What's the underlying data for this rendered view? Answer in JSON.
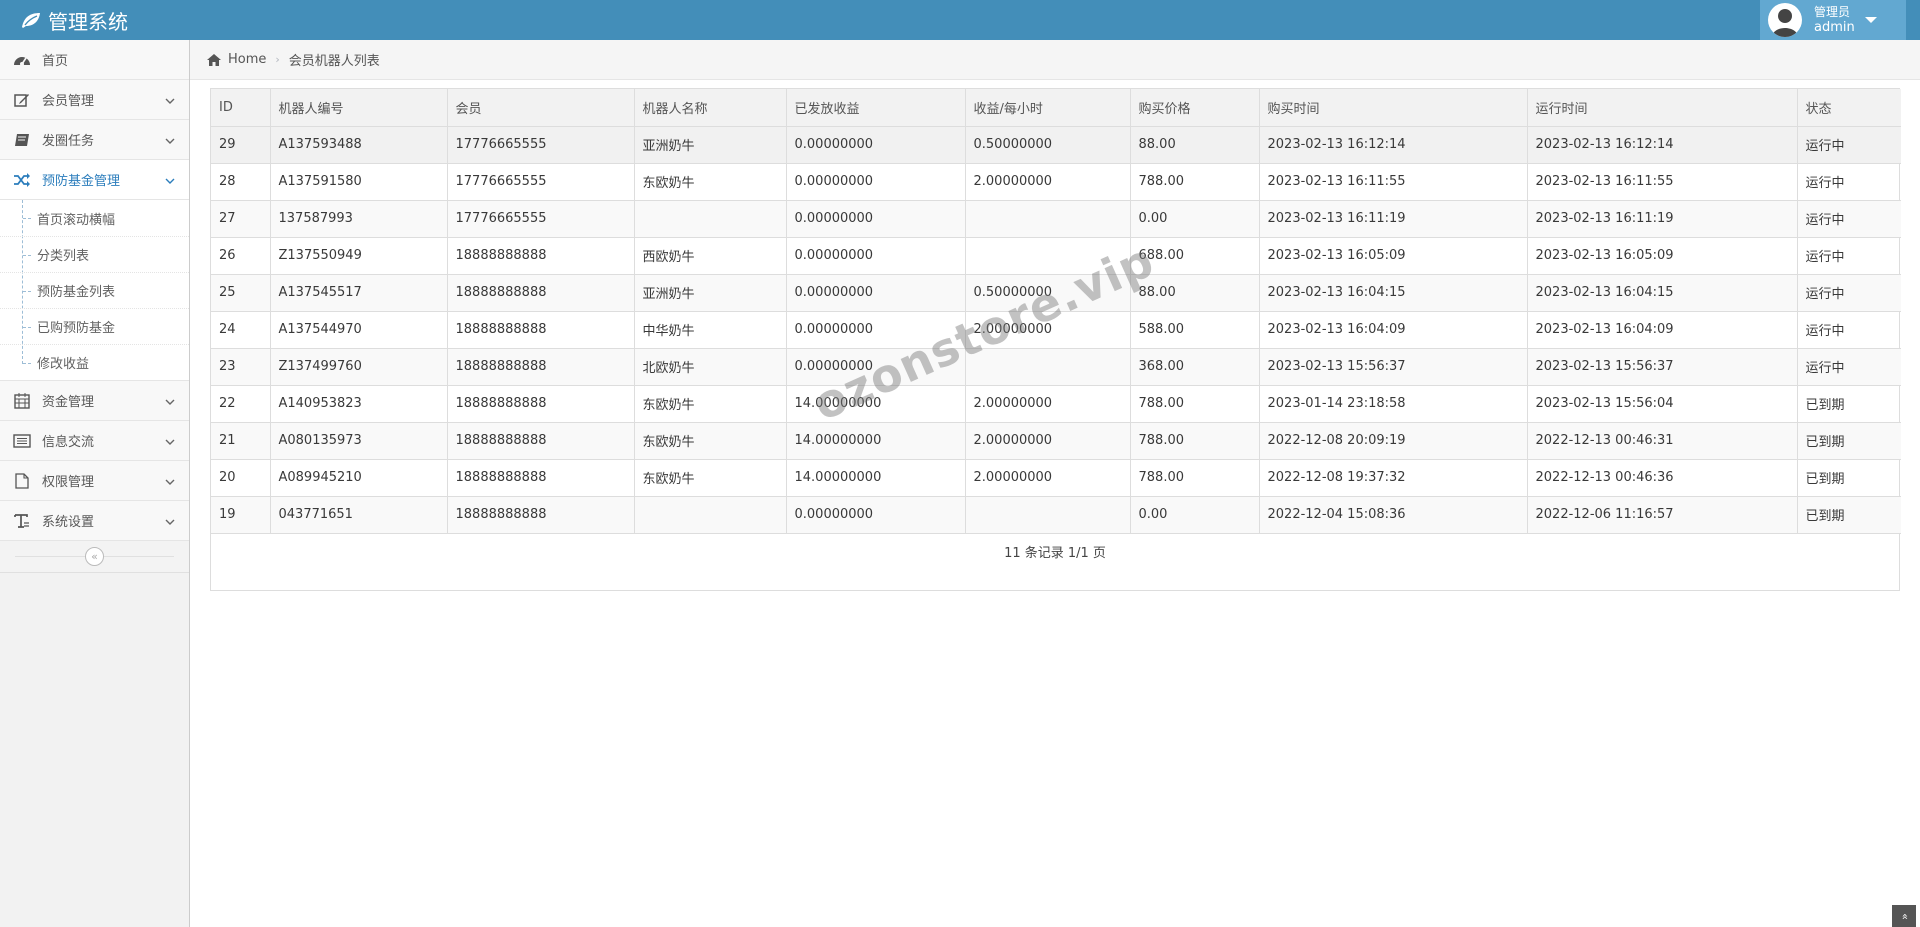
{
  "navbar": {
    "brand": "管理系统",
    "user_role": "管理员",
    "user_name": "admin"
  },
  "sidebar": {
    "items": [
      {
        "label": "首页",
        "icon": "dashboard-icon"
      },
      {
        "label": "会员管理",
        "icon": "edit-icon"
      },
      {
        "label": "发圈任务",
        "icon": "book-icon"
      },
      {
        "label": "预防基金管理",
        "icon": "shuffle-icon"
      },
      {
        "label": "资金管理",
        "icon": "calendar-icon"
      },
      {
        "label": "信息交流",
        "icon": "list-icon"
      },
      {
        "label": "权限管理",
        "icon": "file-icon"
      },
      {
        "label": "系统设置",
        "icon": "text-icon"
      }
    ],
    "submenu": [
      "首页滚动横幅",
      "分类列表",
      "预防基金列表",
      "已购预防基金",
      "修改收益"
    ],
    "collapse_glyph": "«"
  },
  "breadcrumb": {
    "home": "Home",
    "current": "会员机器人列表"
  },
  "table": {
    "headers": [
      "ID",
      "机器人编号",
      "会员",
      "机器人名称",
      "已发放收益",
      "收益/每小时",
      "购买价格",
      "购买时间",
      "运行时间",
      "状态"
    ],
    "rows": [
      [
        "29",
        "A137593488",
        "17776665555",
        "亚洲奶牛",
        "0.00000000",
        "0.50000000",
        "88.00",
        "2023-02-13 16:12:14",
        "2023-02-13 16:12:14",
        "运行中"
      ],
      [
        "28",
        "A137591580",
        "17776665555",
        "东欧奶牛",
        "0.00000000",
        "2.00000000",
        "788.00",
        "2023-02-13 16:11:55",
        "2023-02-13 16:11:55",
        "运行中"
      ],
      [
        "27",
        "137587993",
        "17776665555",
        "",
        "0.00000000",
        "",
        "0.00",
        "2023-02-13 16:11:19",
        "2023-02-13 16:11:19",
        "运行中"
      ],
      [
        "26",
        "Z137550949",
        "18888888888",
        "西欧奶牛",
        "0.00000000",
        "",
        "688.00",
        "2023-02-13 16:05:09",
        "2023-02-13 16:05:09",
        "运行中"
      ],
      [
        "25",
        "A137545517",
        "18888888888",
        "亚洲奶牛",
        "0.00000000",
        "0.50000000",
        "88.00",
        "2023-02-13 16:04:15",
        "2023-02-13 16:04:15",
        "运行中"
      ],
      [
        "24",
        "A137544970",
        "18888888888",
        "中华奶牛",
        "0.00000000",
        "2.00000000",
        "588.00",
        "2023-02-13 16:04:09",
        "2023-02-13 16:04:09",
        "运行中"
      ],
      [
        "23",
        "Z137499760",
        "18888888888",
        "北欧奶牛",
        "0.00000000",
        "",
        "368.00",
        "2023-02-13 15:56:37",
        "2023-02-13 15:56:37",
        "运行中"
      ],
      [
        "22",
        "A140953823",
        "18888888888",
        "东欧奶牛",
        "14.00000000",
        "2.00000000",
        "788.00",
        "2023-01-14 23:18:58",
        "2023-02-13 15:56:04",
        "已到期"
      ],
      [
        "21",
        "A080135973",
        "18888888888",
        "东欧奶牛",
        "14.00000000",
        "2.00000000",
        "788.00",
        "2022-12-08 20:09:19",
        "2022-12-13 00:46:31",
        "已到期"
      ],
      [
        "20",
        "A089945210",
        "18888888888",
        "东欧奶牛",
        "14.00000000",
        "2.00000000",
        "788.00",
        "2022-12-08 19:37:32",
        "2022-12-13 00:46:36",
        "已到期"
      ],
      [
        "19",
        "043771651",
        "18888888888",
        "",
        "0.00000000",
        "",
        "0.00",
        "2022-12-04 15:08:36",
        "2022-12-06 11:16:57",
        "已到期"
      ]
    ]
  },
  "pagination": {
    "summary": "11 条记录 1/1 页"
  },
  "watermark": "ozonstore.vip",
  "scroll_top_glyph": "»"
}
